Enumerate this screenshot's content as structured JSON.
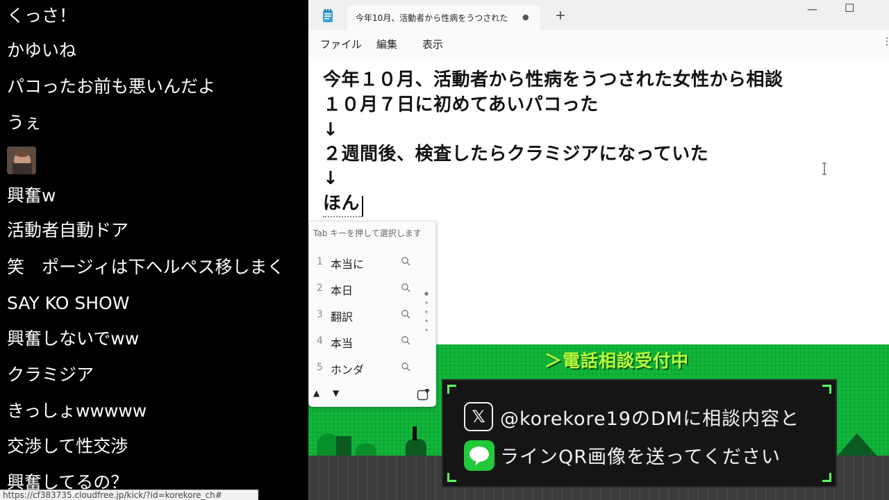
{
  "chat": {
    "messages": [
      "くっさ！",
      "かゆいね",
      "パコったお前も悪いんだよ",
      "うぇ",
      "興奮w",
      "活動者自動ドア",
      "笑　ポージィは下ヘルペス移しまく",
      "SAY KO SHOW",
      "興奮しないでww",
      "クラミジア",
      "きっしょwwwww",
      "交渉して性交渉",
      "興奮してるの？"
    ],
    "status_url": "https://cf383735.cloudfree.jp/kick/?id=korekore_ch#"
  },
  "notepad": {
    "tab_title": "今年10月、活動者から性病をうつされた",
    "tab_modified": "●",
    "new_tab": "+",
    "window_controls": {
      "minimize": "—",
      "maximize": "☐"
    },
    "menu": {
      "file": "ファイル",
      "edit": "編集",
      "view": "表示"
    },
    "menu_more_glyph": "⋮",
    "lines": [
      "今年１０月、活動者から性病をうつされた女性から相談",
      "１０月７日に初めてあいパコった",
      "↓",
      "２週間後、検査したらクラミジアになっていた",
      "↓",
      "ほん"
    ]
  },
  "ime": {
    "hint": "Tab キーを押して選択します",
    "candidates": [
      {
        "num": "1",
        "text": "本当に"
      },
      {
        "num": "2",
        "text": "本日"
      },
      {
        "num": "3",
        "text": "翻訳"
      },
      {
        "num": "4",
        "text": "本当"
      },
      {
        "num": "5",
        "text": "ホンダ"
      }
    ],
    "up": "▲",
    "down": "▼"
  },
  "overlay": {
    "banner": "＞電話相談受付中",
    "line1": "@korekore19のDMに相談内容と",
    "line2": "ラインQR画像を送ってください",
    "x_glyph": "𝕏"
  },
  "colors": {
    "overlay_green": "#11b73a",
    "banner_text": "#b7ff3c",
    "panel_bg": "#151515",
    "line_green": "#22c93a"
  }
}
